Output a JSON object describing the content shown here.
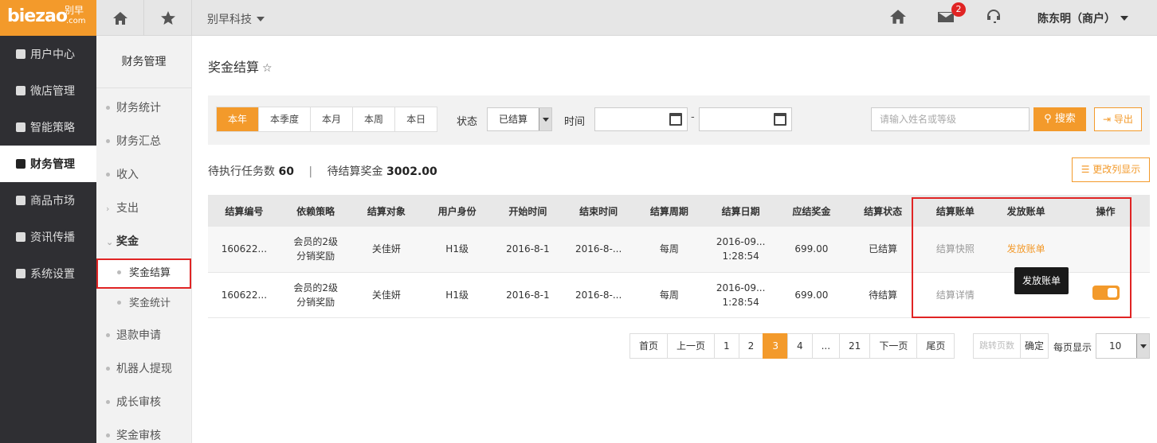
{
  "brand": {
    "logo_text": "biezao",
    "logo_cn": "别早",
    "logo_com": ".com"
  },
  "header": {
    "company": "别早科技",
    "mail_count": "2",
    "user": "陈东明（商户）"
  },
  "leftnav": [
    {
      "label": "用户中心",
      "icon": "user-icon"
    },
    {
      "label": "微店管理",
      "icon": "shop-icon"
    },
    {
      "label": "智能策略",
      "icon": "strategy-icon"
    },
    {
      "label": "财务管理",
      "icon": "money-bag-icon",
      "active": true
    },
    {
      "label": "商品市场",
      "icon": "market-icon"
    },
    {
      "label": "资讯传播",
      "icon": "grid-icon"
    },
    {
      "label": "系统设置",
      "icon": "gear-icon"
    }
  ],
  "subnav": {
    "title": "财务管理",
    "items": [
      "财务统计",
      "财务汇总",
      "收入",
      "支出",
      "奖金"
    ],
    "bonus_children": [
      "奖金结算",
      "奖金统计"
    ],
    "after": [
      "退款申请",
      "机器人提现",
      "成长审核",
      "奖金审核"
    ]
  },
  "page": {
    "title": "奖金结算",
    "star": "☆"
  },
  "filter": {
    "ranges": [
      "本年",
      "本季度",
      "本月",
      "本周",
      "本日"
    ],
    "status_label": "状态",
    "status_value": "已结算",
    "time_label": "时间",
    "date_sep": "-",
    "search_placeholder": "请输入姓名或等级",
    "search_btn": "搜索",
    "export_btn": "导出"
  },
  "summary": {
    "tasks_label": "待执行任务数",
    "tasks_value": "60",
    "sep": "|",
    "pending_label": "待结算奖金",
    "pending_value": "3002.00",
    "columns_btn": "更改列显示"
  },
  "table": {
    "headers": [
      "结算编号",
      "依赖策略",
      "结算对象",
      "用户身份",
      "开始时间",
      "结束时间",
      "结算周期",
      "结算日期",
      "应结奖金",
      "结算状态",
      "结算账单",
      "发放账单",
      "操作"
    ],
    "rows": [
      {
        "id": "160622...",
        "strategy1": "会员的2级",
        "strategy2": "分销奖励",
        "target": "关佳妍",
        "level": "H1级",
        "start": "2016-8-1",
        "end": "2016-8-...",
        "cycle": "每周",
        "date1": "2016-09...",
        "date2": "1:28:54",
        "amount": "699.00",
        "status": "已结算",
        "bill": "结算快照",
        "payout": "发放账单"
      },
      {
        "id": "160622...",
        "strategy1": "会员的2级",
        "strategy2": "分销奖励",
        "target": "关佳妍",
        "level": "H1级",
        "start": "2016-8-1",
        "end": "2016-8-...",
        "cycle": "每周",
        "date1": "2016-09...",
        "date2": "1:28:54",
        "amount": "699.00",
        "status": "待结算",
        "bill": "结算详情",
        "payout": ""
      }
    ],
    "tooltip": "发放账单"
  },
  "pagination": {
    "pages": [
      "首页",
      "上一页",
      "1",
      "2",
      "3",
      "4",
      "...",
      "21",
      "下一页",
      "尾页"
    ],
    "current": "3",
    "jump_placeholder": "跳转页数",
    "jump_ok": "确定",
    "per_page_label": "每页显示",
    "per_page_value": "10"
  },
  "colors": {
    "accent": "#f39a2b",
    "nav_bg": "#2f2f33",
    "highlight": "#e02424"
  }
}
